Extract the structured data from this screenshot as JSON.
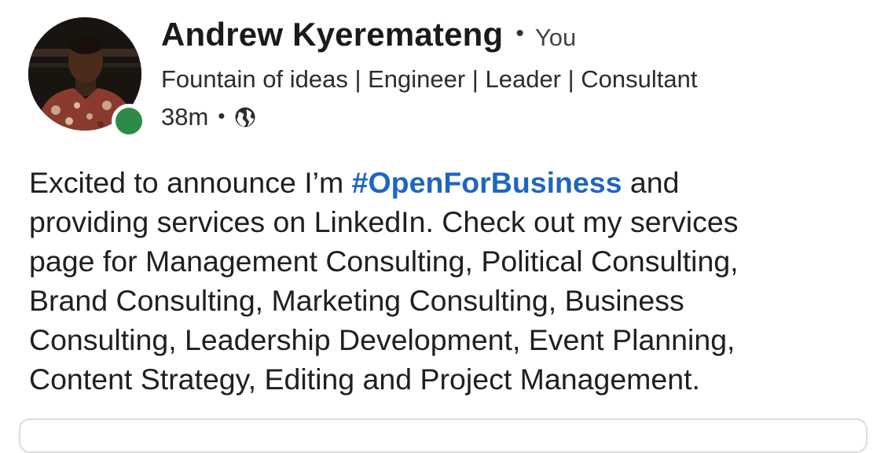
{
  "post": {
    "author": {
      "name": "Andrew Kyeremateng",
      "degree_separator": "•",
      "degree": "You",
      "headline": "Fountain of ideas | Engineer | Leader | Consultant",
      "online_status_color": "#2e8b47"
    },
    "meta": {
      "time_ago": "38m",
      "separator": "•",
      "visibility_icon": "globe-icon"
    },
    "body": {
      "line1_before": "Excited to announce I’m ",
      "hashtag": "#OpenForBusiness",
      "line1_after": " and",
      "line2": "providing services on LinkedIn. Check out my services",
      "line3": "page for Management Consulting, Political Consulting,",
      "line4": "Brand Consulting, Marketing Consulting, Business",
      "line5": "Consulting, Leadership Development, Event Planning,",
      "line6": "Content Strategy, Editing and Project Management."
    },
    "colors": {
      "hashtag": "#1e66c1"
    }
  }
}
